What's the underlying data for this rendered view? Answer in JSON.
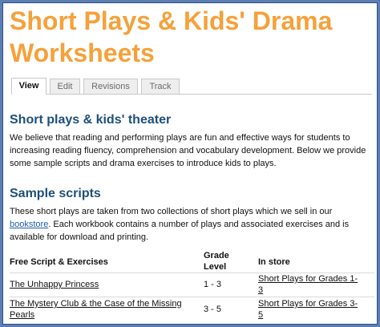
{
  "page": {
    "title": "Short Plays & Kids' Drama Worksheets",
    "tabs": [
      "View",
      "Edit",
      "Revisions",
      "Track"
    ],
    "active_tab": "View"
  },
  "intro": {
    "heading": "Short plays & kids' theater",
    "text": "We believe that reading and performing plays are fun and effective ways for students to increasing reading fluency, comprehension and vocabulary development.  Below we provide some sample scripts and drama exercises to introduce kids to plays."
  },
  "samples": {
    "heading": "Sample scripts",
    "text_before": "These short plays are taken from two collections of short plays which we sell in our ",
    "bookstore_link": "bookstore",
    "text_after": ". Each workbook contains a number of plays and associated exercises and is available for download and printing."
  },
  "table": {
    "headers": {
      "script": "Free Script & Exercises",
      "grade": "Grade Level",
      "store": "In store"
    },
    "rows": [
      {
        "script": "The Unhappy Princess",
        "grade": "1 - 3",
        "store": "Short Plays for Grades 1-3"
      },
      {
        "script": "The Mystery Club & the Case of the Missing Pearls",
        "grade": "3 - 5",
        "store": "Short Plays for Grades 3-5"
      }
    ]
  },
  "colors": {
    "title": "#f5a13b",
    "heading": "#1d4f7c",
    "link": "#1f5fa8",
    "border": "#5b7fb3"
  }
}
